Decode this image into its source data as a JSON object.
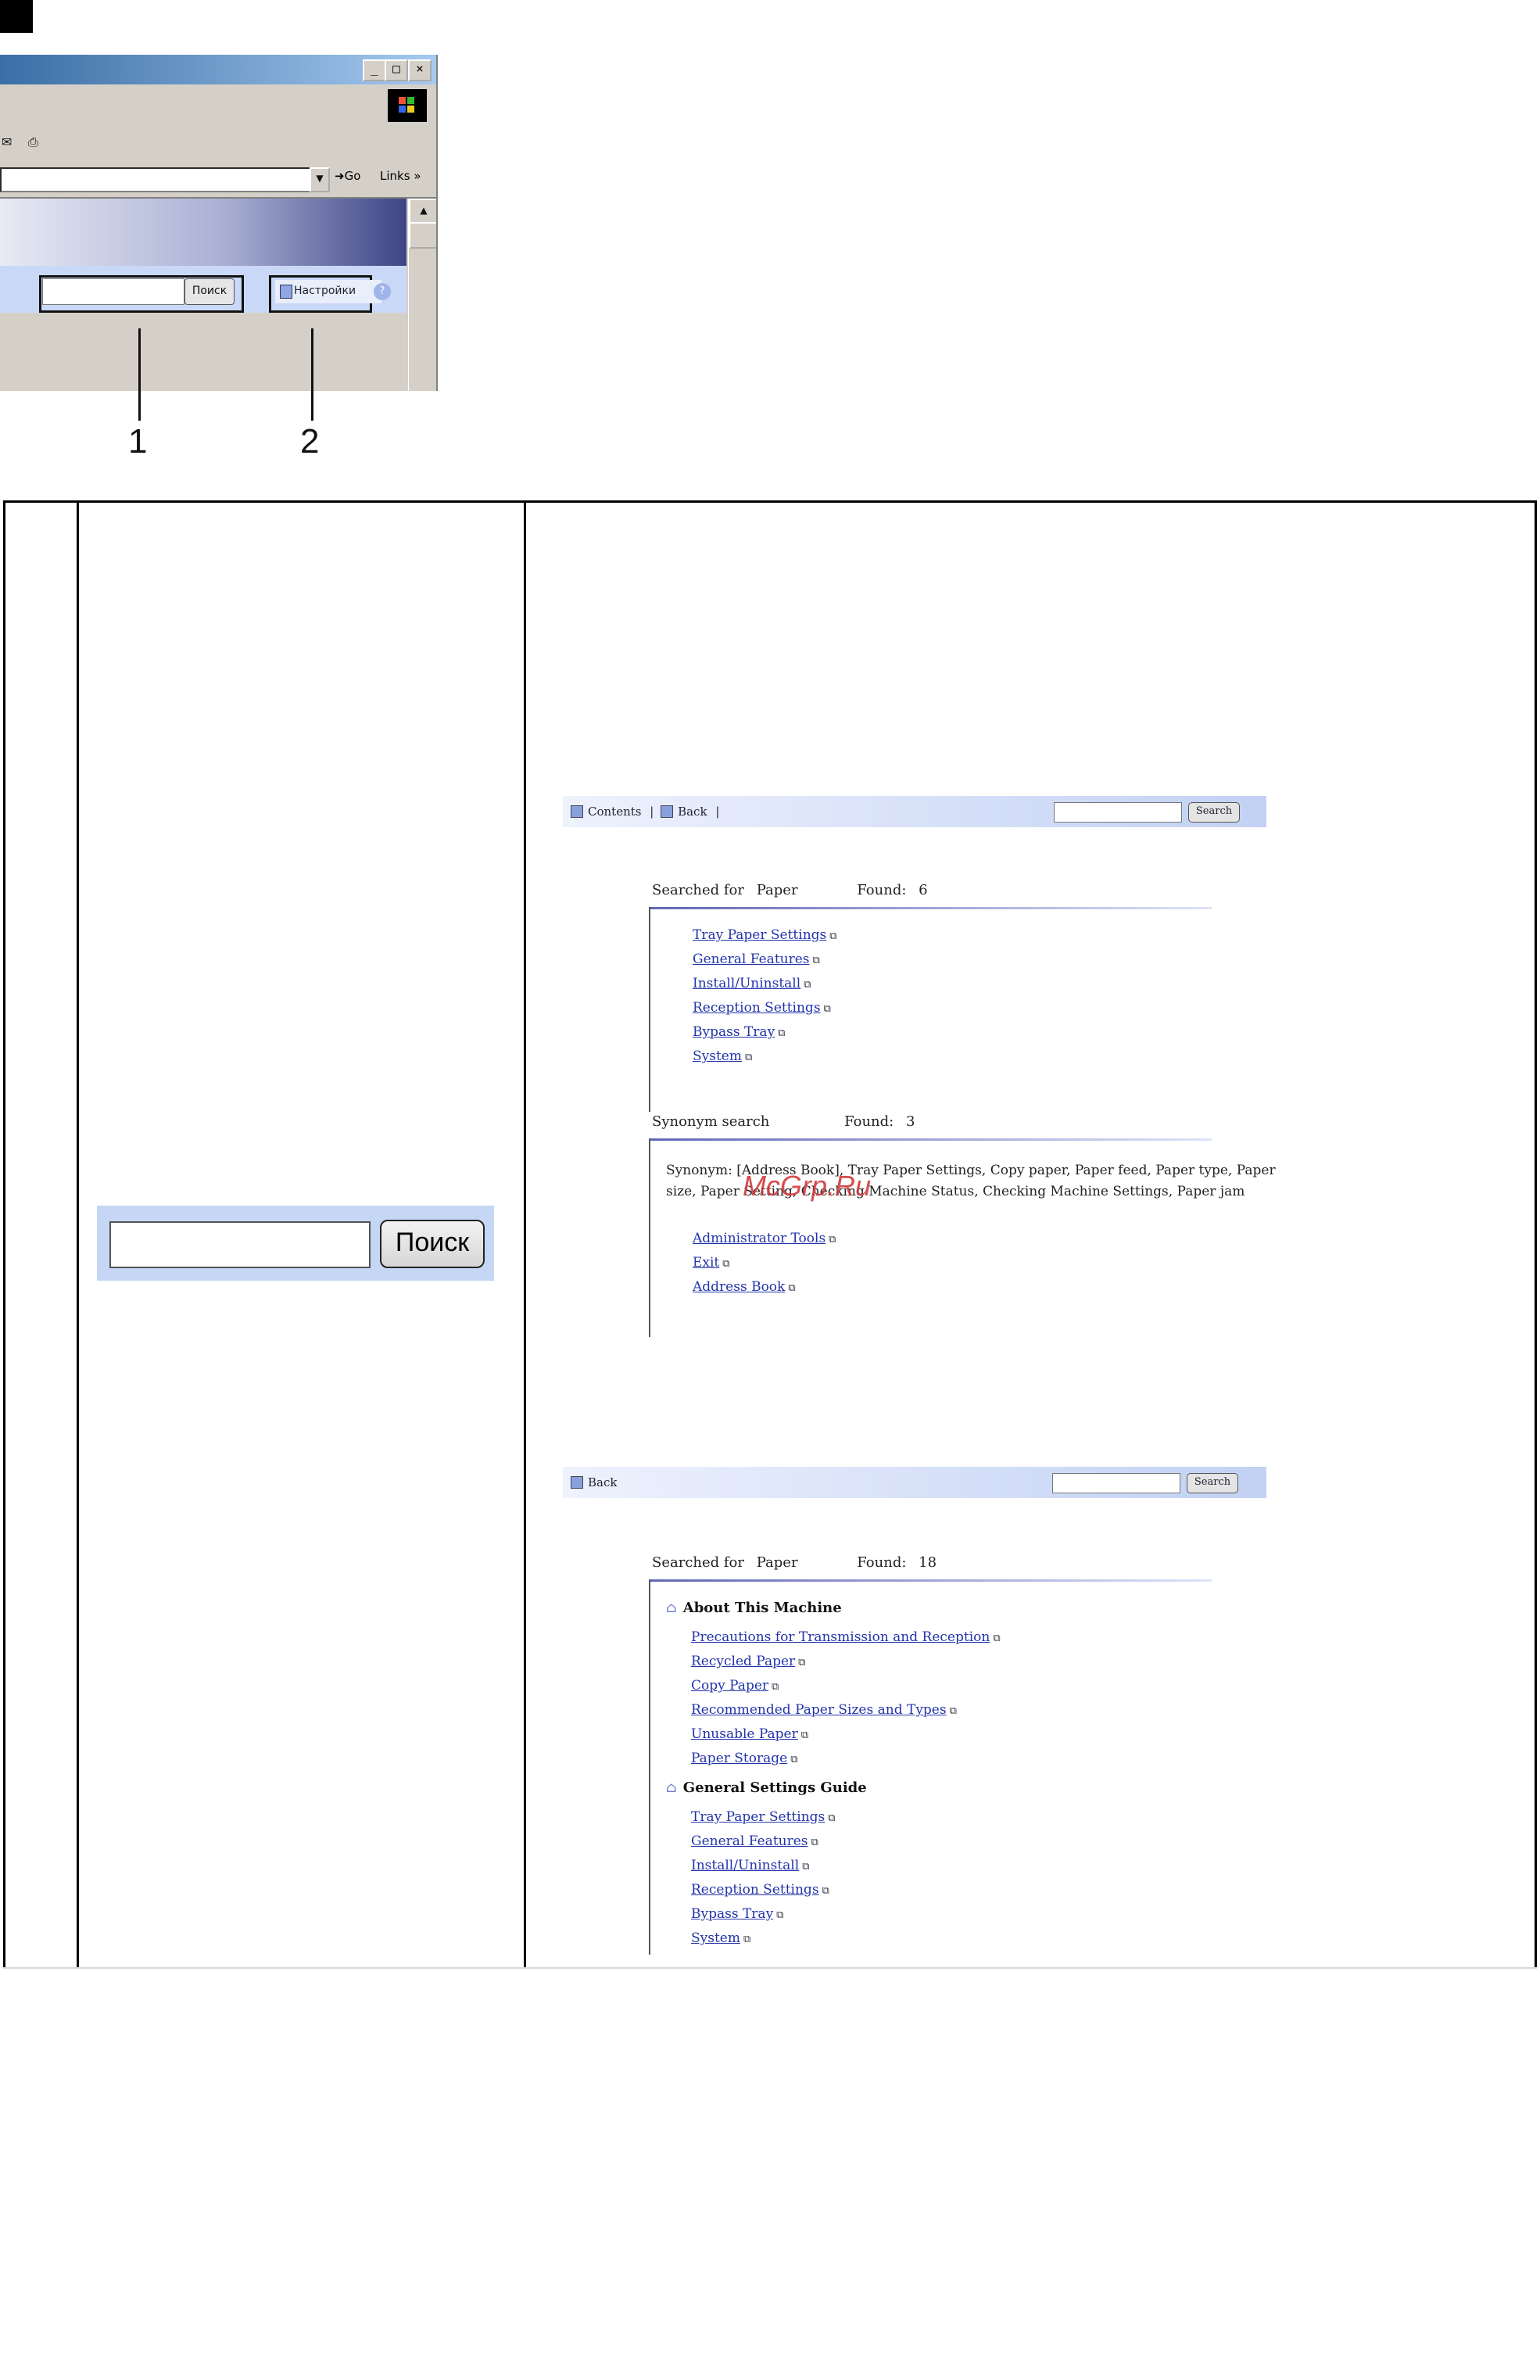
{
  "corner_marker": "",
  "browser": {
    "window_buttons": [
      "_",
      "□",
      "×"
    ],
    "go_label": "Go",
    "links_label": "Links",
    "links_chevron": "»",
    "search_button": "Поиск",
    "settings_button": "Настройки",
    "help_icon": "?"
  },
  "callouts": [
    "1",
    "2"
  ],
  "table": {
    "ru_search_button": "Поиск",
    "watermark": "McGrp.Ru",
    "shot1": {
      "nav_contents": "Contents",
      "nav_back": "Back",
      "nav_sep_open": "|",
      "nav_sep_close": "|",
      "search_button": "Search",
      "searched_for_label": "Searched for",
      "searched_for_value": "Paper",
      "found_label": "Found:",
      "found_value": "6",
      "links": [
        "Tray Paper Settings",
        "General Features",
        "Install/Uninstall",
        "Reception Settings",
        "Bypass Tray",
        "System"
      ],
      "synonym_label": "Synonym search",
      "synonym_found_label": "Found:",
      "synonym_found_value": "3",
      "synonym_text": "Synonym: [Address Book], Tray Paper Settings, Copy paper, Paper feed, Paper type, Paper size, Paper Setting, Checking Machine Status, Checking Machine Settings, Paper jam",
      "synonym_links": [
        "Administrator Tools",
        "Exit",
        "Address Book"
      ]
    },
    "shot2": {
      "nav_back": "Back",
      "search_button": "Search",
      "searched_for_label": "Searched for",
      "searched_for_value": "Paper",
      "found_label": "Found:",
      "found_value": "18",
      "section1": "About This Machine",
      "section1_links": [
        "Precautions for Transmission and Reception",
        "Recycled Paper",
        "Copy Paper",
        "Recommended Paper Sizes and Types",
        "Unusable Paper",
        "Paper Storage"
      ],
      "section2": "General Settings Guide",
      "section2_links": [
        "Tray Paper Settings",
        "General Features",
        "Install/Uninstall",
        "Reception Settings",
        "Bypass Tray",
        "System"
      ]
    }
  }
}
